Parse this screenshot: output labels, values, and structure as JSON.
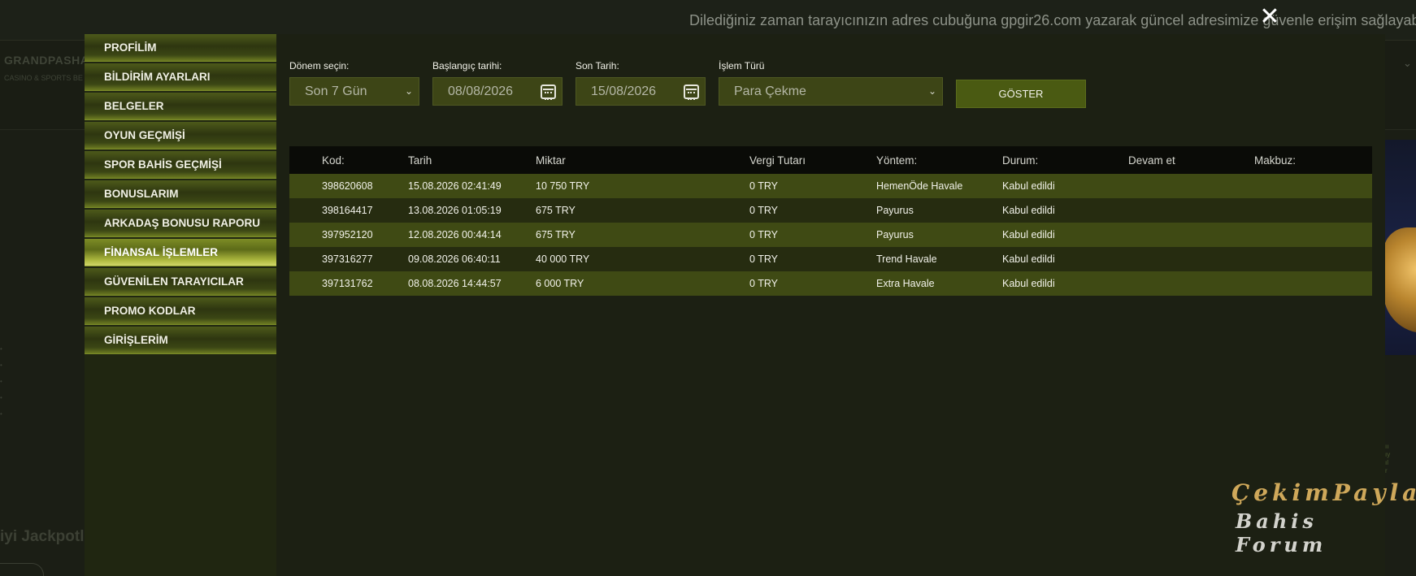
{
  "ticker": {
    "text": "Dilediğiniz zaman tarayıcınızın adres cubuğuna gpgir26.com yazarak güncel adresimize güvenle erişim sağlayab"
  },
  "background": {
    "logo": "GRANDPASHA",
    "logo_sub": "CASINO & SPORTS BE",
    "jackpot": "iyi Jackpotla"
  },
  "sidebar": {
    "items": [
      {
        "label": "PROFİLİM"
      },
      {
        "label": "BİLDİRİM AYARLARI"
      },
      {
        "label": "BELGELER"
      },
      {
        "label": "OYUN GEÇMİŞİ"
      },
      {
        "label": "SPOR BAHİS GEÇMİŞİ"
      },
      {
        "label": "BONUSLARIM"
      },
      {
        "label": "ARKADAŞ BONUSU RAPORU"
      },
      {
        "label": "FİNANSAL İŞLEMLER"
      },
      {
        "label": "GÜVENİLEN TARAYICILAR"
      },
      {
        "label": "PROMO KODLAR"
      },
      {
        "label": "GİRİŞLERİM"
      }
    ],
    "active_index": 7
  },
  "filters": {
    "period_label": "Dönem seçin:",
    "period_value": "Son 7 Gün",
    "start_label": "Başlangıç tarihi:",
    "start_value": "08/08/2026",
    "end_label": "Son Tarih:",
    "end_value": "15/08/2026",
    "type_label": "İşlem Türü",
    "type_value": "Para Çekme",
    "show_button": "GÖSTER"
  },
  "table": {
    "headers": [
      "Kod:",
      "Tarih",
      "Miktar",
      "Vergi Tutarı",
      "Yöntem:",
      "Durum:",
      "Devam et",
      "Makbuz:"
    ],
    "rows": [
      [
        "398620608",
        "15.08.2026 02:41:49",
        "10 750 TRY",
        "0 TRY",
        "HemenÖde Havale",
        "Kabul edildi"
      ],
      [
        "398164417",
        "13.08.2026 01:05:19",
        "675 TRY",
        "0 TRY",
        "Payurus",
        "Kabul edildi"
      ],
      [
        "397952120",
        "12.08.2026 00:44:14",
        "675 TRY",
        "0 TRY",
        "Payurus",
        "Kabul edildi"
      ],
      [
        "397316277",
        "09.08.2026 06:40:11",
        "40 000 TRY",
        "0 TRY",
        "Trend Havale",
        "Kabul edildi"
      ],
      [
        "397131762",
        "08.08.2026 14:44:57",
        "6 000 TRY",
        "0 TRY",
        "Extra Havale",
        "Kabul edildi"
      ]
    ]
  },
  "watermark": {
    "line1": "ÇekimPaylaş",
    "line2": "Bahis Forum"
  },
  "icons": {
    "close": "close-icon",
    "calendar": "calendar-icon",
    "dropdown": "chevron-down-icon"
  }
}
